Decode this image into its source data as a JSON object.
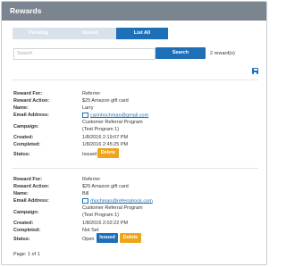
{
  "header": {
    "title": "Rewards"
  },
  "tabs": [
    {
      "label": "Pending"
    },
    {
      "label": "Issued"
    },
    {
      "label": "List All"
    }
  ],
  "search": {
    "placeholder": "Search",
    "button_label": "Search",
    "result_count": "2 reward(s)"
  },
  "labels": {
    "reward_for": "Reward For:",
    "reward_action": "Reward Action:",
    "name": "Name:",
    "email": "Email Address:",
    "campaign": "Campaign:",
    "created": "Created:",
    "completed": "Completed:",
    "status": "Status:"
  },
  "rewards": [
    {
      "reward_for": "Referrer",
      "reward_action": "$25 Amazon gift card",
      "name": "Larry",
      "email": "carinhochman@gmail.com",
      "campaign_line1": "Customer Referral Program",
      "campaign_line2": "(Test Program 1)",
      "created": "1/8/2016 2:19:07 PM",
      "completed": "1/8/2016 2:45:25 PM",
      "status": "Issued",
      "delete_label": "Delete"
    },
    {
      "reward_for": "Referrer",
      "reward_action": "$25 Amazon gift card",
      "name": "Bill",
      "email": "rhochman@referralrock.com",
      "campaign_line1": "Customer Referral Program",
      "campaign_line2": "(Test Program 1)",
      "created": "1/8/2016 2:02:22 PM",
      "completed": "Not Set",
      "status": "Open",
      "issued_label": "Issued",
      "delete_label": "Delete"
    }
  ],
  "pagination": {
    "text": "Page: 1 of 1"
  },
  "colors": {
    "header_bg": "#7b858f",
    "primary": "#1d70b8",
    "warning": "#f0a41a"
  }
}
